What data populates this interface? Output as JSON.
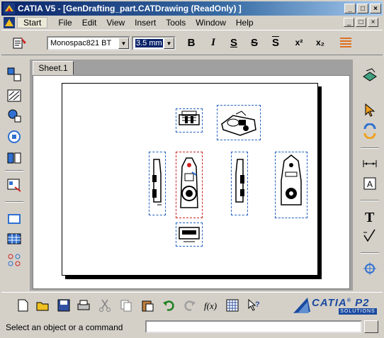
{
  "window": {
    "title": "CATIA V5 - [GenDrafting_part.CATDrawing (ReadOnly) ]",
    "minimize": "_",
    "maximize": "□",
    "close": "×"
  },
  "menu": {
    "items": [
      "Start",
      "File",
      "Edit",
      "View",
      "Insert",
      "Tools",
      "Window",
      "Help"
    ]
  },
  "format_toolbar": {
    "font_name": "Monospac821 BT",
    "font_size": "3.5 mm",
    "bold": "B",
    "italic": "I",
    "underline": "S",
    "strikethrough": "S",
    "overline": "S",
    "superscript": "x²",
    "subscript": "x₂"
  },
  "sheet": {
    "tab_label": "Sheet.1"
  },
  "status": {
    "prompt": "Select an object or a command",
    "input_value": ""
  },
  "branding": {
    "logo_text": "CATIA",
    "logo_suffix": "P2",
    "logo_sub": "SOLUTIONS"
  },
  "colors": {
    "title_bar": "#0a246a",
    "view_frame": "#2060c0",
    "active_view_frame": "#d02020",
    "workspace_bg": "#a0a0a0"
  }
}
